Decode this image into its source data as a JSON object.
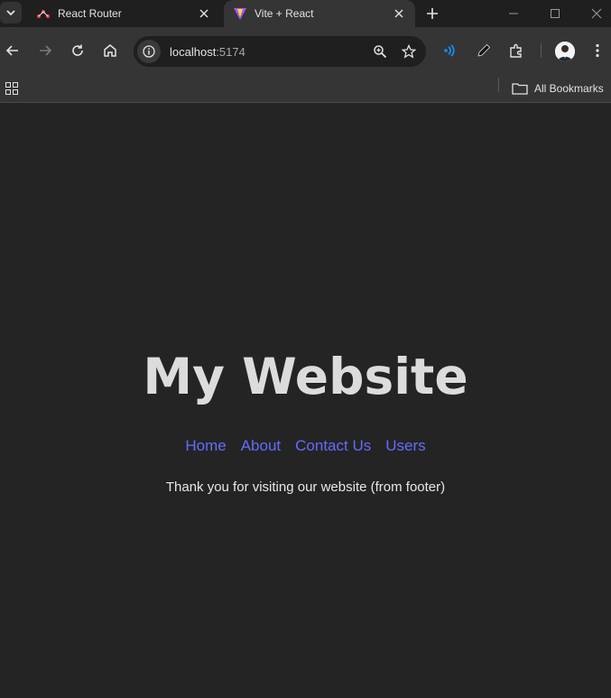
{
  "browser": {
    "tabs": [
      {
        "title": "React Router",
        "favicon": "react-router-icon",
        "active": false
      },
      {
        "title": "Vite + React",
        "favicon": "vite-icon",
        "active": true
      }
    ],
    "address": {
      "host": "localhost",
      "port": ":5174"
    },
    "bookmarks": {
      "all_label": "All Bookmarks"
    }
  },
  "page": {
    "title": "My Website",
    "nav": [
      "Home",
      "About",
      "Contact Us",
      "Users"
    ],
    "footer": "Thank you for visiting our website (from footer)"
  },
  "colors": {
    "link": "#646cff",
    "background": "#242424",
    "chrome_toolbar": "#353535",
    "chrome_tabstrip": "#1f1f1f"
  }
}
